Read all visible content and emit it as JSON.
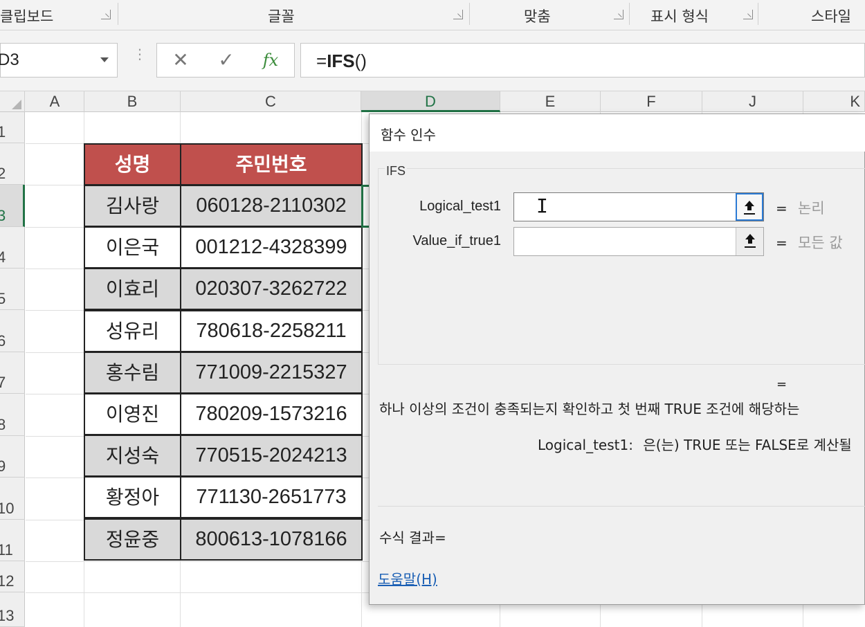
{
  "ribbon": {
    "groups": [
      {
        "label": "클립보드"
      },
      {
        "label": "글꼴"
      },
      {
        "label": "맞춤"
      },
      {
        "label": "표시 형식"
      },
      {
        "label": "스타일"
      }
    ]
  },
  "formula_bar": {
    "name_box": "D3",
    "cancel_icon": "✕",
    "enter_icon": "✓",
    "fx_label": "fx",
    "formula_prefix": "=",
    "formula_func": "IFS",
    "formula_suffix": "()"
  },
  "grid": {
    "columns": [
      "A",
      "B",
      "C",
      "D",
      "E",
      "F",
      "J",
      "K"
    ],
    "selected_column": "D",
    "rows": [
      "1",
      "2",
      "3",
      "4",
      "5",
      "6",
      "7",
      "8",
      "9",
      "10",
      "11",
      "12",
      "13"
    ],
    "selected_row": "3"
  },
  "table": {
    "headers": [
      "성명",
      "주민번호"
    ],
    "rows": [
      {
        "name": "김사랑",
        "id": "060128-2110302"
      },
      {
        "name": "이은국",
        "id": "001212-4328399"
      },
      {
        "name": "이효리",
        "id": "020307-3262722"
      },
      {
        "name": "성유리",
        "id": "780618-2258211"
      },
      {
        "name": "홍수림",
        "id": "771009-2215327"
      },
      {
        "name": "이영진",
        "id": "780209-1573216"
      },
      {
        "name": "지성숙",
        "id": "770515-2024213"
      },
      {
        "name": "황정아",
        "id": "771130-2651773"
      },
      {
        "name": "정윤중",
        "id": "800613-1078166"
      }
    ]
  },
  "dialog": {
    "title": "함수 인수",
    "function_name": "IFS",
    "args": [
      {
        "label": "Logical_test1",
        "value": "",
        "hint": "논리"
      },
      {
        "label": "Value_if_true1",
        "value": "",
        "hint": "모든 값"
      }
    ],
    "equals": "=",
    "description": "하나 이상의 조건이 충족되는지 확인하고 첫 번째 TRUE 조건에 해당하는",
    "arg_description_label": "Logical_test1:",
    "arg_description": "은(는) TRUE 또는 FALSE로 계산될",
    "result_label": "수식 결과=",
    "help_link": "도움말(H)"
  },
  "colors": {
    "header_fill": "#c0504d",
    "shaded_row": "#d9d9d9",
    "excel_green": "#217346",
    "link_blue": "#1a5fb4"
  }
}
